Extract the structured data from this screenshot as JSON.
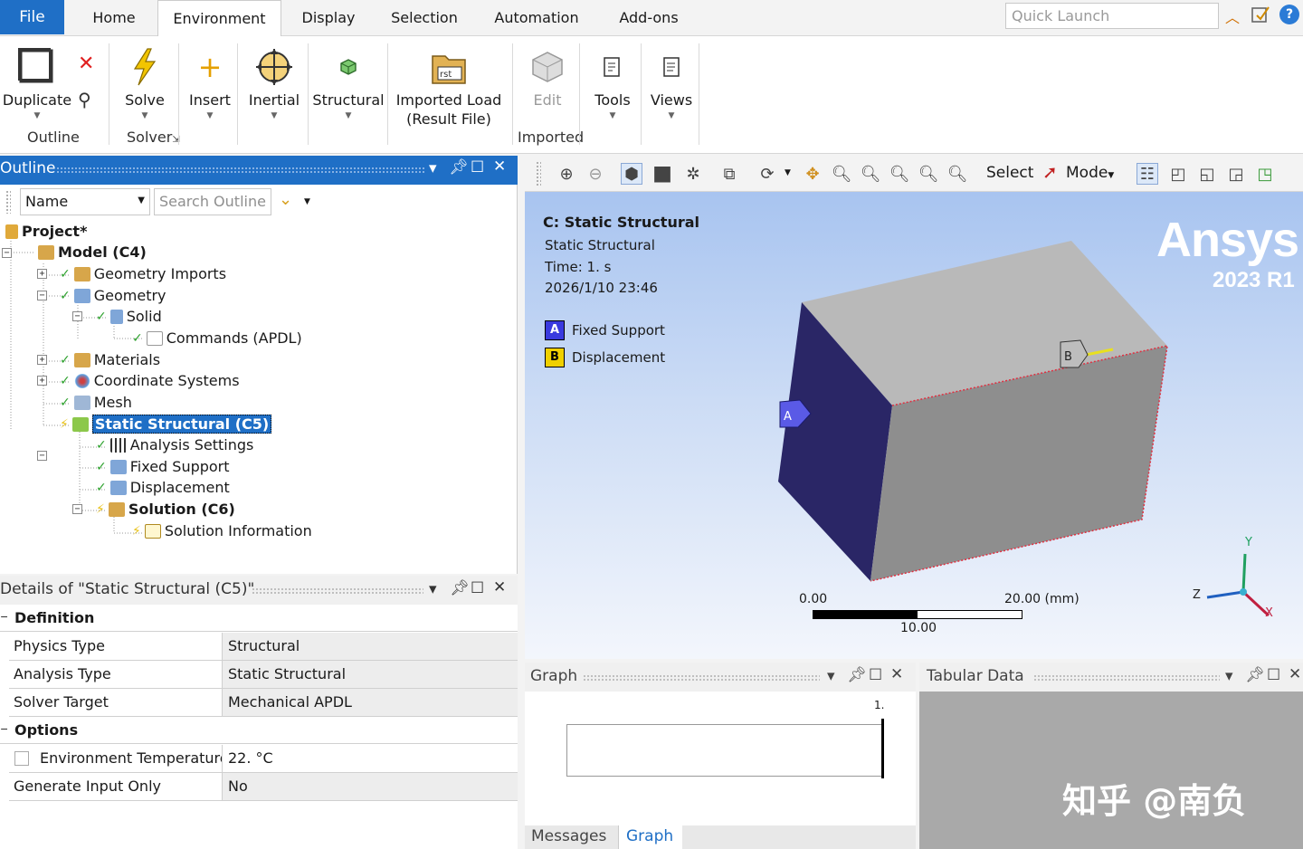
{
  "menu": {
    "file": "File",
    "tabs": [
      "Home",
      "Environment",
      "Display",
      "Selection",
      "Automation",
      "Add-ons"
    ],
    "quick_launch_placeholder": "Quick Launch"
  },
  "ribbon": {
    "duplicate": "Duplicate",
    "outline_group": "Outline",
    "solve": "Solve",
    "solver_group": "Solver",
    "insert": "Insert",
    "inertial": "Inertial",
    "structural": "Structural",
    "imported_load_line1": "Imported Load",
    "imported_load_line2": "(Result File)",
    "edit": "Edit",
    "imported_group": "Imported",
    "tools": "Tools",
    "views": "Views"
  },
  "outline": {
    "title": "Outline",
    "filter_value": "Name",
    "search_placeholder": "Search Outline",
    "tree": {
      "project": "Project*",
      "model": "Model (C4)",
      "geometry_imports": "Geometry Imports",
      "geometry": "Geometry",
      "solid": "Solid",
      "commands": "Commands (APDL)",
      "materials": "Materials",
      "coordinate_systems": "Coordinate Systems",
      "mesh": "Mesh",
      "static_structural": "Static Structural (C5)",
      "analysis_settings": "Analysis Settings",
      "fixed_support": "Fixed Support",
      "displacement": "Displacement",
      "solution": "Solution (C6)",
      "solution_information": "Solution Information"
    }
  },
  "details": {
    "title": "Details of \"Static Structural (C5)\"",
    "definition": "Definition",
    "rows1": [
      {
        "k": "Physics Type",
        "v": "Structural"
      },
      {
        "k": "Analysis Type",
        "v": "Static Structural"
      },
      {
        "k": "Solver Target",
        "v": "Mechanical APDL"
      }
    ],
    "options": "Options",
    "rows2": [
      {
        "k": "Environment Temperature",
        "v": "22. °C"
      },
      {
        "k": "Generate Input Only",
        "v": "No"
      }
    ]
  },
  "view_toolbar": {
    "select": "Select",
    "mode": "Mode"
  },
  "viewport": {
    "title": "C: Static Structural",
    "subtitle": "Static Structural",
    "time": "Time: 1. s",
    "date": "2026/1/10 23:46",
    "legend": [
      {
        "tag": "A",
        "label": "Fixed Support",
        "color": "#3a3adf"
      },
      {
        "tag": "B",
        "label": "Displacement",
        "color": "#f0d000"
      }
    ],
    "logo": "Ansys",
    "version": "2023 R1",
    "scale_min": "0.00",
    "scale_max": "20.00 (mm)",
    "scale_mid": "10.00",
    "axis_x": "X",
    "axis_y": "Y",
    "axis_z": "Z",
    "tag_a": "A",
    "tag_b": "B"
  },
  "graph": {
    "title": "Graph",
    "tick": "1.",
    "tab_messages": "Messages",
    "tab_graph": "Graph"
  },
  "tabular": {
    "title": "Tabular Data"
  },
  "watermark": "知乎 @南负"
}
